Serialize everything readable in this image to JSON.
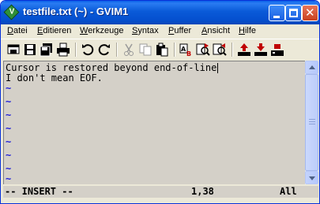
{
  "window": {
    "title": "testfile.txt (~) - GVIM1",
    "buttons": {
      "minimize": "minimize",
      "maximize": "maximize",
      "close": "✕"
    }
  },
  "menu": [
    {
      "label": "Datei",
      "accel": "D",
      "rest": "atei"
    },
    {
      "label": "Editieren",
      "accel": "E",
      "rest": "ditieren"
    },
    {
      "label": "Werkzeuge",
      "accel": "W",
      "rest": "erkzeuge"
    },
    {
      "label": "Syntax",
      "accel": "S",
      "rest": "yntax"
    },
    {
      "label": "Puffer",
      "accel": "P",
      "rest": "uffer"
    },
    {
      "label": "Ansicht",
      "accel": "A",
      "rest": "nsicht"
    },
    {
      "label": "Hilfe",
      "accel": "H",
      "rest": "ilfe"
    }
  ],
  "toolbar": {
    "icons": [
      "open-icon",
      "save-icon",
      "save-all-icon",
      "print-icon",
      "undo-icon",
      "redo-icon",
      "cut-icon",
      "copy-icon",
      "paste-icon",
      "replace-icon",
      "find-next-icon",
      "find-prev-icon",
      "load-session-icon",
      "save-session-icon",
      "run-script-icon"
    ]
  },
  "editor": {
    "lines": [
      "Cursor is restored beyond end-of-line",
      "I don't mean EOF."
    ],
    "empty_marker": "~",
    "empty_line_count": 9
  },
  "status": {
    "mode": "-- INSERT --",
    "position": "1,38",
    "scroll": "All"
  },
  "colors": {
    "titlebar": "#0a5ad8",
    "editor_bg": "#d4d0c8",
    "tilde": "#2020d8",
    "chrome": "#ece9d8"
  }
}
